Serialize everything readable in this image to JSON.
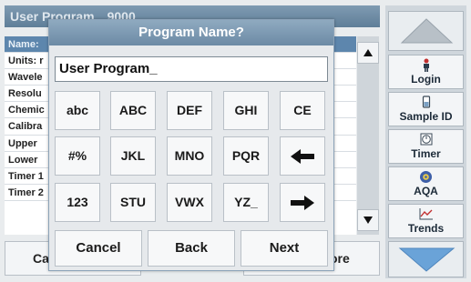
{
  "background": {
    "header": {
      "title": "User Program",
      "number": "9000"
    },
    "list_rows": [
      "Name:",
      "Units: r",
      "Wavele",
      "Resolu",
      "Chemic",
      "Calibra",
      "Upper",
      "Lower",
      "Timer 1",
      "Timer 2"
    ],
    "bottom": {
      "left_label": "Ca",
      "right_label": "ore"
    }
  },
  "sidebar": {
    "login": {
      "label": "Login",
      "icon": "person-icon"
    },
    "sample_id": {
      "label": "Sample ID",
      "icon": "sample-tube-icon"
    },
    "timer": {
      "label": "Timer",
      "icon": "clock-icon"
    },
    "aqa": {
      "label": "AQA",
      "icon": "aqa-icon"
    },
    "trends": {
      "label": "Trends",
      "icon": "chart-icon"
    }
  },
  "dialog": {
    "title": "Program Name?",
    "input_value": "User Program_",
    "keys": [
      [
        "abc",
        "ABC",
        "DEF",
        "GHI",
        "CE"
      ],
      [
        "#%",
        "JKL",
        "MNO",
        "PQR",
        "←"
      ],
      [
        "123",
        "STU",
        "VWX",
        "YZ_",
        "→"
      ]
    ],
    "actions": {
      "cancel": "Cancel",
      "back": "Back",
      "next": "Next"
    }
  },
  "colors": {
    "title_bar": "#6c8aa5",
    "selected_row": "#5d86ad",
    "arrow_blue": "#6aa3d8"
  }
}
